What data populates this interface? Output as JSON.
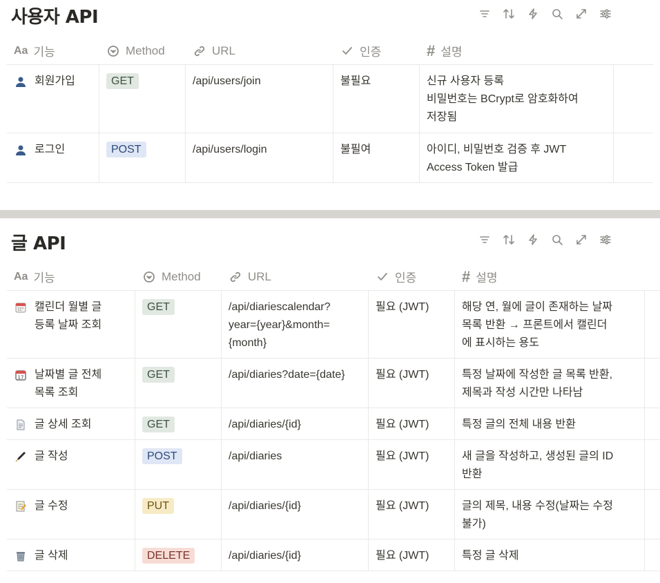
{
  "users_section": {
    "title": "사용자 API",
    "toolbar": [
      "filter-icon",
      "sort-icon",
      "automation-icon",
      "search-icon",
      "expand-icon",
      "settings-icon"
    ],
    "headers": {
      "feature": "기능",
      "method": "Method",
      "url": "URL",
      "auth": "인증",
      "desc": "설명",
      "aa": "Aa"
    },
    "rows": [
      {
        "icon": "person-icon",
        "feature": "회원가입",
        "method": "GET",
        "url": "/api/users/join",
        "auth": "불필요",
        "desc": [
          "신규 사용자 등록",
          "비밀번호는 BCrypt로 암호화하여",
          "저장됨"
        ]
      },
      {
        "icon": "person-icon",
        "feature": "로그인",
        "method": "POST",
        "url": "/api/users/login",
        "auth": "불필여",
        "desc": [
          "아이디, 비밀번호 검증 후 JWT",
          "Access Token 발급"
        ]
      }
    ]
  },
  "posts_section": {
    "title": "글 API",
    "toolbar": [
      "filter-icon",
      "sort-icon",
      "automation-icon",
      "search-icon",
      "expand-icon",
      "settings-icon"
    ],
    "headers": {
      "feature": "기능",
      "method": "Method",
      "url": "URL",
      "auth": "인증",
      "desc": "설명",
      "aa": "Aa"
    },
    "rows": [
      {
        "icon": "calendar-icon",
        "feature": [
          "캘린더 월별 글",
          "등록 날짜 조회"
        ],
        "method": "GET",
        "url": [
          "/api/diariescalendar?",
          "year={year}&month=",
          "{month}"
        ],
        "auth": "필요 (JWT)",
        "desc": [
          "해당 연, 월에 글이 존재하는 날짜",
          "목록 반환 → 프론트에서 캘린더",
          "에 표시하는 용도"
        ]
      },
      {
        "icon": "date-calendar-icon",
        "feature": [
          "날짜별 글 전체",
          "목록 조회"
        ],
        "method": "GET",
        "url": [
          "/api/diaries?date={date}"
        ],
        "auth": "필요 (JWT)",
        "desc": [
          "특정 날짜에 작성한 글 목록 반환,",
          "제목과 작성 시간만 나타남"
        ]
      },
      {
        "icon": "document-icon",
        "feature": [
          "글 상세 조회"
        ],
        "method": "GET",
        "url": [
          "/api/diaries/{id}"
        ],
        "auth": "필요 (JWT)",
        "desc": [
          "특정 글의 전체 내용 반환"
        ]
      },
      {
        "icon": "pen-icon",
        "feature": [
          "글 작성"
        ],
        "method": "POST",
        "url": [
          "/api/diaries"
        ],
        "auth": "필요 (JWT)",
        "desc": [
          "새 글을 작성하고, 생성된 글의 ID",
          "반환"
        ]
      },
      {
        "icon": "memo-icon",
        "feature": [
          "글 수정"
        ],
        "method": "PUT",
        "url": [
          "/api/diaries/{id}"
        ],
        "auth": "필요 (JWT)",
        "desc": [
          "글의 제목, 내용 수정(날짜는 수정",
          "불가)"
        ]
      },
      {
        "icon": "trash-icon",
        "feature": [
          "글 삭제"
        ],
        "method": "DELETE",
        "url": [
          "/api/diaries/{id}"
        ],
        "auth": "필요 (JWT)",
        "desc": [
          "특정 글 삭제"
        ]
      }
    ]
  }
}
